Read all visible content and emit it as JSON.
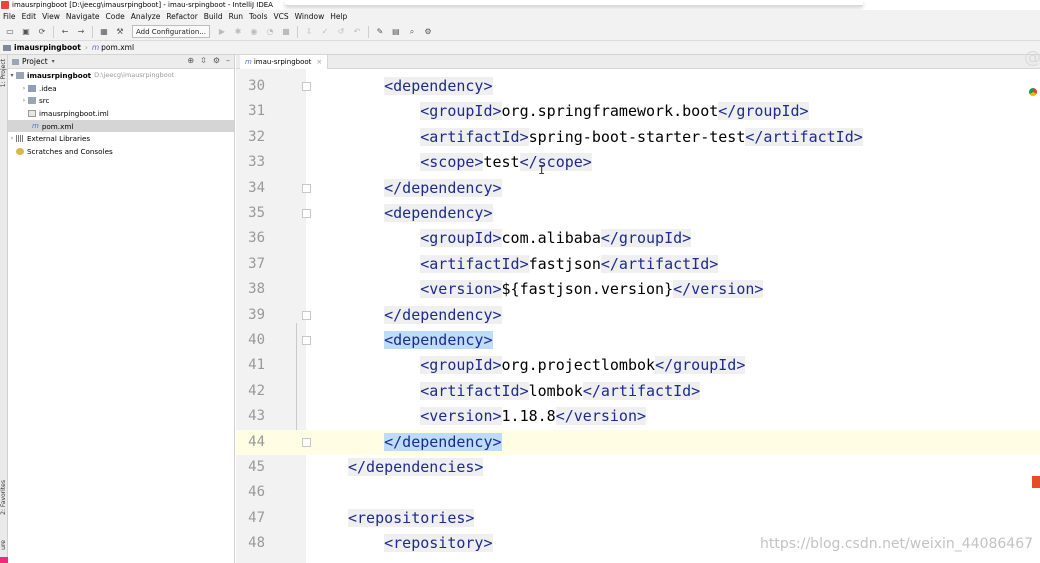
{
  "window": {
    "title": "imausrpingboot [D:\\jeecg\\imausrpingboot] - imau-srpingboot - IntelliJ IDEA"
  },
  "menu": [
    "File",
    "Edit",
    "View",
    "Navigate",
    "Code",
    "Analyze",
    "Refactor",
    "Build",
    "Run",
    "Tools",
    "VCS",
    "Window",
    "Help"
  ],
  "toolbar": {
    "add_configuration": "Add Configuration..."
  },
  "breadcrumb": {
    "project": "imausrpingboot",
    "file": "pom.xml"
  },
  "project_panel": {
    "title": "Project",
    "tree": [
      {
        "label": "imausrpingboot",
        "path": "D:\\jeecg\\imausrpingboot"
      },
      {
        "label": ".idea"
      },
      {
        "label": "src"
      },
      {
        "label": "imausrpingboot.iml"
      },
      {
        "label": "pom.xml"
      },
      {
        "label": "External Libraries"
      },
      {
        "label": "Scratches and Consoles"
      }
    ]
  },
  "side_strip": {
    "project_label": "1: Project",
    "favorites_label": "2: Favorites",
    "structure_label": "ure"
  },
  "editor": {
    "tab": "imau-srpingboot",
    "lines": [
      {
        "num": "30",
        "indent": "    ",
        "parts": [
          {
            "t": "<dependency>",
            "k": "tag"
          }
        ]
      },
      {
        "num": "31",
        "indent": "        ",
        "parts": [
          {
            "t": "<groupId>",
            "k": "tag"
          },
          {
            "t": "org.springframework.boot",
            "k": "text"
          },
          {
            "t": "</groupId>",
            "k": "tag"
          }
        ]
      },
      {
        "num": "32",
        "indent": "        ",
        "parts": [
          {
            "t": "<artifactId>",
            "k": "tag"
          },
          {
            "t": "spring-boot-starter-test",
            "k": "text"
          },
          {
            "t": "</artifactId>",
            "k": "tag"
          }
        ]
      },
      {
        "num": "33",
        "indent": "        ",
        "parts": [
          {
            "t": "<scope>",
            "k": "tag"
          },
          {
            "t": "test",
            "k": "text"
          },
          {
            "t": "</scope>",
            "k": "tag"
          }
        ]
      },
      {
        "num": "34",
        "indent": "    ",
        "parts": [
          {
            "t": "</dependency>",
            "k": "tag"
          }
        ]
      },
      {
        "num": "35",
        "indent": "    ",
        "parts": [
          {
            "t": "<dependency>",
            "k": "tag"
          }
        ]
      },
      {
        "num": "36",
        "indent": "        ",
        "parts": [
          {
            "t": "<groupId>",
            "k": "tag"
          },
          {
            "t": "com.alibaba",
            "k": "text"
          },
          {
            "t": "</groupId>",
            "k": "tag"
          }
        ]
      },
      {
        "num": "37",
        "indent": "        ",
        "parts": [
          {
            "t": "<artifactId>",
            "k": "tag"
          },
          {
            "t": "fastjson",
            "k": "text"
          },
          {
            "t": "</artifactId>",
            "k": "tag"
          }
        ]
      },
      {
        "num": "38",
        "indent": "        ",
        "parts": [
          {
            "t": "<version>",
            "k": "tag"
          },
          {
            "t": "${fastjson.version}",
            "k": "text"
          },
          {
            "t": "</version>",
            "k": "tag"
          }
        ]
      },
      {
        "num": "39",
        "indent": "    ",
        "parts": [
          {
            "t": "</dependency>",
            "k": "tag"
          }
        ]
      },
      {
        "num": "40",
        "indent": "    ",
        "parts": [
          {
            "t": "<dependency>",
            "k": "tag-hl"
          }
        ]
      },
      {
        "num": "41",
        "indent": "        ",
        "parts": [
          {
            "t": "<groupId>",
            "k": "tag"
          },
          {
            "t": "org.projectlombok",
            "k": "text"
          },
          {
            "t": "</groupId>",
            "k": "tag"
          }
        ]
      },
      {
        "num": "42",
        "indent": "        ",
        "parts": [
          {
            "t": "<artifactId>",
            "k": "tag"
          },
          {
            "t": "lombok",
            "k": "text"
          },
          {
            "t": "</artifactId>",
            "k": "tag"
          }
        ]
      },
      {
        "num": "43",
        "indent": "        ",
        "parts": [
          {
            "t": "<version>",
            "k": "tag"
          },
          {
            "t": "1.18.8",
            "k": "text"
          },
          {
            "t": "</version>",
            "k": "tag"
          }
        ]
      },
      {
        "num": "44",
        "indent": "    ",
        "parts": [
          {
            "t": "</dependency>",
            "k": "tag-hl"
          }
        ]
      },
      {
        "num": "45",
        "indent": "",
        "parts": [
          {
            "t": "</dependencies>",
            "k": "tag"
          }
        ]
      },
      {
        "num": "46",
        "indent": "",
        "parts": []
      },
      {
        "num": "47",
        "indent": "",
        "parts": [
          {
            "t": "<repositories>",
            "k": "tag"
          }
        ]
      },
      {
        "num": "48",
        "indent": "    ",
        "parts": [
          {
            "t": "<repository>",
            "k": "tag"
          }
        ]
      }
    ]
  },
  "watermark": "https://blog.csdn.net/weixin_44086467"
}
